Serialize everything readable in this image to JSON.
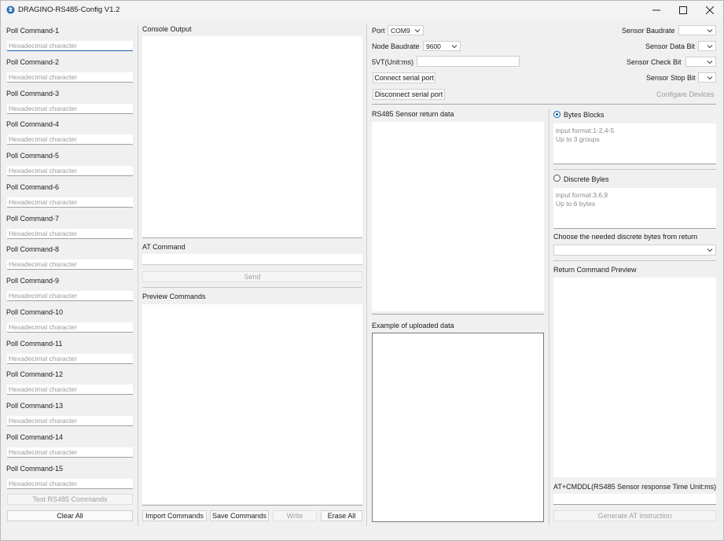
{
  "window": {
    "title": "DRAGINO-RS485-Config V1.2"
  },
  "poll": {
    "placeholder": "Hexadecimal character",
    "items": [
      {
        "label": "Poll Command-1"
      },
      {
        "label": "Poll Command-2"
      },
      {
        "label": "Poll Command-3"
      },
      {
        "label": "Poll Command-4"
      },
      {
        "label": "Poll Command-5"
      },
      {
        "label": "Poll Command-6"
      },
      {
        "label": "Poll Command-7"
      },
      {
        "label": "Poll Command-8"
      },
      {
        "label": "Poll Command-9"
      },
      {
        "label": "Poll Command-10"
      },
      {
        "label": "Poll Command-11"
      },
      {
        "label": "Poll Command-12"
      },
      {
        "label": "Poll Command-13"
      },
      {
        "label": "Poll Command-14"
      },
      {
        "label": "Poll Command-15"
      }
    ],
    "test_button": "Test RS485 Commands",
    "clear_button": "Clear All"
  },
  "console": {
    "title": "Console Output",
    "at_label": "AT Command",
    "send_button": "Send",
    "preview_label": "Preview Commands",
    "import_button": "Import Commands",
    "save_button": "Save Commands",
    "write_button": "Write",
    "erase_button": "Erase All"
  },
  "port": {
    "port_label": "Port",
    "port_value": "COM9",
    "node_baud_label": "Node Baudrate",
    "node_baud_value": "9600",
    "fivevt_label": "5VT(Unit:ms)",
    "fivevt_value": "",
    "connect_button": "Connect serial port",
    "disconnect_button": "Disconnect serial port"
  },
  "sensor": {
    "baud_label": "Sensor Baudrate",
    "databit_label": "Sensor Data Bit",
    "checkbit_label": "Sensor Check Bit",
    "stopbit_label": "Sensor Stop Bit",
    "configure_button": "Configare Devices"
  },
  "data": {
    "return_label": "RS485 Sensor return data",
    "uploaded_label": "Example of uploaded data"
  },
  "blocks": {
    "bytes_blocks_label": "Bytes Blocks",
    "bytes_blocks_selected": true,
    "bytes_blocks_hint": "input format:1-2,4-5\nUp to 3 groups",
    "discrete_label": "Discrete Byles",
    "discrete_selected": false,
    "discrete_hint": "input format:3,6,9\nUp to 6 bytes",
    "choose_label": "Choose the needed discrete bytes from return",
    "preview_label": "Return Command Preview",
    "cmddl_label": "AT+CMDDL(RS485 Sensor response Time Unit:ms)",
    "generate_button": "Generate AT instruction"
  },
  "colors": {
    "accent": "#1a5fb4",
    "window_bg": "#f0f0f0",
    "panel_bg": "#ffffff"
  }
}
